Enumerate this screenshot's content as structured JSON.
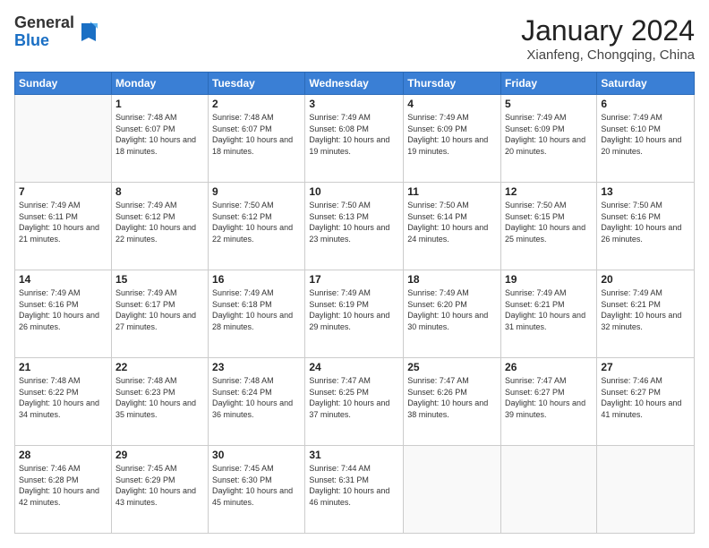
{
  "header": {
    "logo_general": "General",
    "logo_blue": "Blue",
    "month_title": "January 2024",
    "location": "Xianfeng, Chongqing, China"
  },
  "columns": [
    "Sunday",
    "Monday",
    "Tuesday",
    "Wednesday",
    "Thursday",
    "Friday",
    "Saturday"
  ],
  "weeks": [
    [
      {
        "day": "",
        "sunrise": "",
        "sunset": "",
        "daylight": ""
      },
      {
        "day": "1",
        "sunrise": "Sunrise: 7:48 AM",
        "sunset": "Sunset: 6:07 PM",
        "daylight": "Daylight: 10 hours and 18 minutes."
      },
      {
        "day": "2",
        "sunrise": "Sunrise: 7:48 AM",
        "sunset": "Sunset: 6:07 PM",
        "daylight": "Daylight: 10 hours and 18 minutes."
      },
      {
        "day": "3",
        "sunrise": "Sunrise: 7:49 AM",
        "sunset": "Sunset: 6:08 PM",
        "daylight": "Daylight: 10 hours and 19 minutes."
      },
      {
        "day": "4",
        "sunrise": "Sunrise: 7:49 AM",
        "sunset": "Sunset: 6:09 PM",
        "daylight": "Daylight: 10 hours and 19 minutes."
      },
      {
        "day": "5",
        "sunrise": "Sunrise: 7:49 AM",
        "sunset": "Sunset: 6:09 PM",
        "daylight": "Daylight: 10 hours and 20 minutes."
      },
      {
        "day": "6",
        "sunrise": "Sunrise: 7:49 AM",
        "sunset": "Sunset: 6:10 PM",
        "daylight": "Daylight: 10 hours and 20 minutes."
      }
    ],
    [
      {
        "day": "7",
        "sunrise": "Sunrise: 7:49 AM",
        "sunset": "Sunset: 6:11 PM",
        "daylight": "Daylight: 10 hours and 21 minutes."
      },
      {
        "day": "8",
        "sunrise": "Sunrise: 7:49 AM",
        "sunset": "Sunset: 6:12 PM",
        "daylight": "Daylight: 10 hours and 22 minutes."
      },
      {
        "day": "9",
        "sunrise": "Sunrise: 7:50 AM",
        "sunset": "Sunset: 6:12 PM",
        "daylight": "Daylight: 10 hours and 22 minutes."
      },
      {
        "day": "10",
        "sunrise": "Sunrise: 7:50 AM",
        "sunset": "Sunset: 6:13 PM",
        "daylight": "Daylight: 10 hours and 23 minutes."
      },
      {
        "day": "11",
        "sunrise": "Sunrise: 7:50 AM",
        "sunset": "Sunset: 6:14 PM",
        "daylight": "Daylight: 10 hours and 24 minutes."
      },
      {
        "day": "12",
        "sunrise": "Sunrise: 7:50 AM",
        "sunset": "Sunset: 6:15 PM",
        "daylight": "Daylight: 10 hours and 25 minutes."
      },
      {
        "day": "13",
        "sunrise": "Sunrise: 7:50 AM",
        "sunset": "Sunset: 6:16 PM",
        "daylight": "Daylight: 10 hours and 26 minutes."
      }
    ],
    [
      {
        "day": "14",
        "sunrise": "Sunrise: 7:49 AM",
        "sunset": "Sunset: 6:16 PM",
        "daylight": "Daylight: 10 hours and 26 minutes."
      },
      {
        "day": "15",
        "sunrise": "Sunrise: 7:49 AM",
        "sunset": "Sunset: 6:17 PM",
        "daylight": "Daylight: 10 hours and 27 minutes."
      },
      {
        "day": "16",
        "sunrise": "Sunrise: 7:49 AM",
        "sunset": "Sunset: 6:18 PM",
        "daylight": "Daylight: 10 hours and 28 minutes."
      },
      {
        "day": "17",
        "sunrise": "Sunrise: 7:49 AM",
        "sunset": "Sunset: 6:19 PM",
        "daylight": "Daylight: 10 hours and 29 minutes."
      },
      {
        "day": "18",
        "sunrise": "Sunrise: 7:49 AM",
        "sunset": "Sunset: 6:20 PM",
        "daylight": "Daylight: 10 hours and 30 minutes."
      },
      {
        "day": "19",
        "sunrise": "Sunrise: 7:49 AM",
        "sunset": "Sunset: 6:21 PM",
        "daylight": "Daylight: 10 hours and 31 minutes."
      },
      {
        "day": "20",
        "sunrise": "Sunrise: 7:49 AM",
        "sunset": "Sunset: 6:21 PM",
        "daylight": "Daylight: 10 hours and 32 minutes."
      }
    ],
    [
      {
        "day": "21",
        "sunrise": "Sunrise: 7:48 AM",
        "sunset": "Sunset: 6:22 PM",
        "daylight": "Daylight: 10 hours and 34 minutes."
      },
      {
        "day": "22",
        "sunrise": "Sunrise: 7:48 AM",
        "sunset": "Sunset: 6:23 PM",
        "daylight": "Daylight: 10 hours and 35 minutes."
      },
      {
        "day": "23",
        "sunrise": "Sunrise: 7:48 AM",
        "sunset": "Sunset: 6:24 PM",
        "daylight": "Daylight: 10 hours and 36 minutes."
      },
      {
        "day": "24",
        "sunrise": "Sunrise: 7:47 AM",
        "sunset": "Sunset: 6:25 PM",
        "daylight": "Daylight: 10 hours and 37 minutes."
      },
      {
        "day": "25",
        "sunrise": "Sunrise: 7:47 AM",
        "sunset": "Sunset: 6:26 PM",
        "daylight": "Daylight: 10 hours and 38 minutes."
      },
      {
        "day": "26",
        "sunrise": "Sunrise: 7:47 AM",
        "sunset": "Sunset: 6:27 PM",
        "daylight": "Daylight: 10 hours and 39 minutes."
      },
      {
        "day": "27",
        "sunrise": "Sunrise: 7:46 AM",
        "sunset": "Sunset: 6:27 PM",
        "daylight": "Daylight: 10 hours and 41 minutes."
      }
    ],
    [
      {
        "day": "28",
        "sunrise": "Sunrise: 7:46 AM",
        "sunset": "Sunset: 6:28 PM",
        "daylight": "Daylight: 10 hours and 42 minutes."
      },
      {
        "day": "29",
        "sunrise": "Sunrise: 7:45 AM",
        "sunset": "Sunset: 6:29 PM",
        "daylight": "Daylight: 10 hours and 43 minutes."
      },
      {
        "day": "30",
        "sunrise": "Sunrise: 7:45 AM",
        "sunset": "Sunset: 6:30 PM",
        "daylight": "Daylight: 10 hours and 45 minutes."
      },
      {
        "day": "31",
        "sunrise": "Sunrise: 7:44 AM",
        "sunset": "Sunset: 6:31 PM",
        "daylight": "Daylight: 10 hours and 46 minutes."
      },
      {
        "day": "",
        "sunrise": "",
        "sunset": "",
        "daylight": ""
      },
      {
        "day": "",
        "sunrise": "",
        "sunset": "",
        "daylight": ""
      },
      {
        "day": "",
        "sunrise": "",
        "sunset": "",
        "daylight": ""
      }
    ]
  ]
}
